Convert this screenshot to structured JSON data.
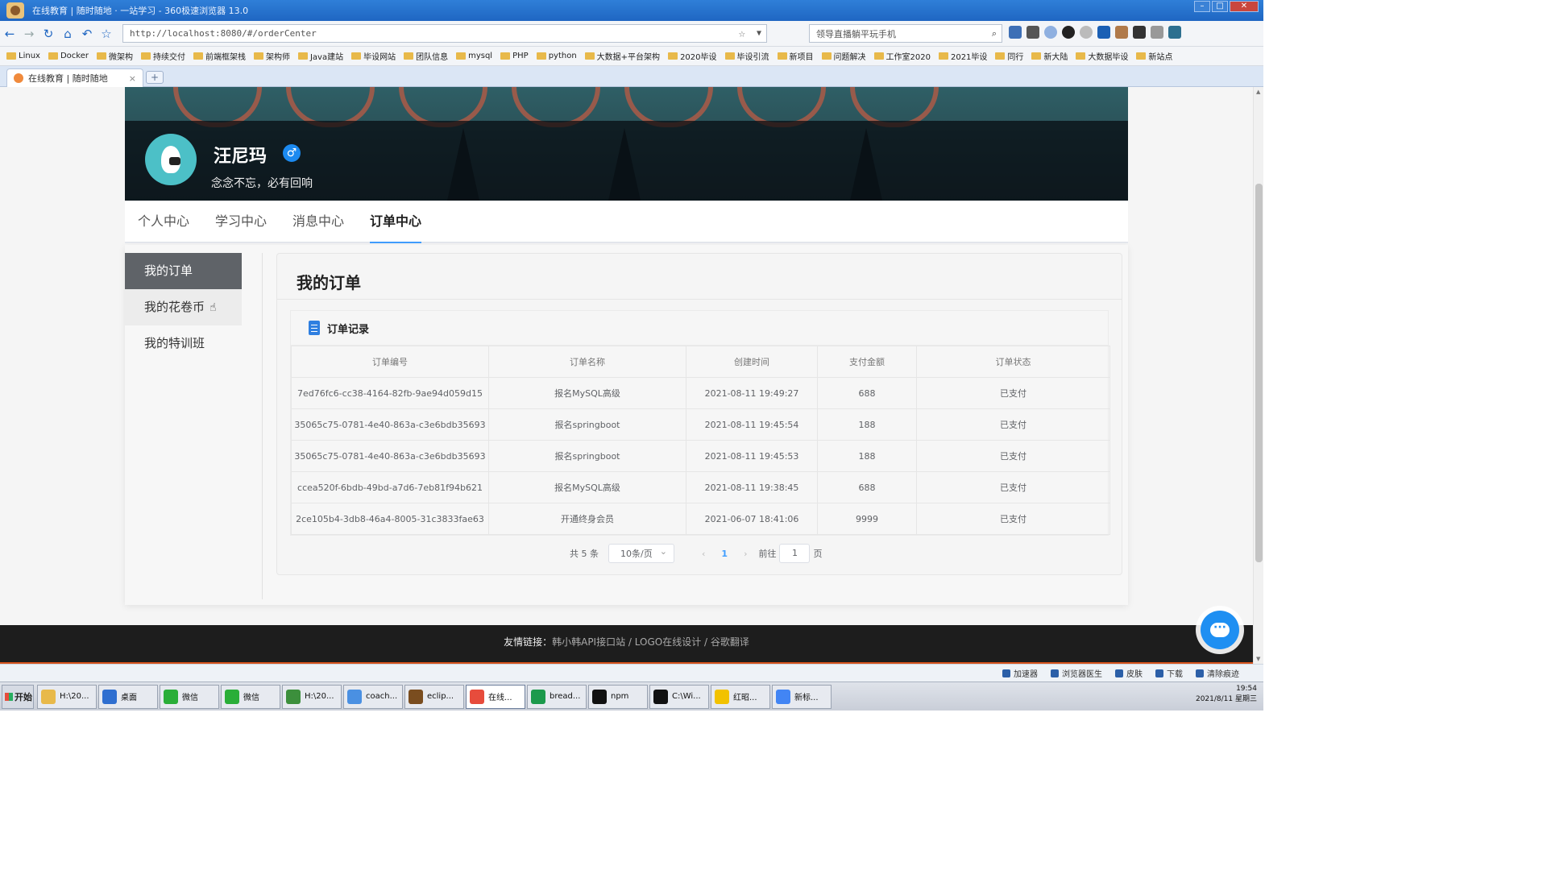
{
  "browser": {
    "title": "在线教育 | 随时随地 · 一站学习 - 360极速浏览器 13.0",
    "address": "http://localhost:8080/#/orderCenter",
    "search_placeholder": "领导直播躺平玩手机",
    "tab_title": "在线教育 | 随时随地",
    "bookmarks": [
      "Linux",
      "Docker",
      "微架构",
      "持续交付",
      "前端框架栈",
      "架构师",
      "Java建站",
      "毕设网站",
      "团队信息",
      "mysql",
      "PHP",
      "python",
      "大数据+平台架构",
      "2020毕设",
      "毕设引流",
      "新项目",
      "问题解决",
      "工作室2020",
      "2021毕设",
      "同行",
      "新大陆",
      "大数据毕设",
      "新站点"
    ]
  },
  "profile": {
    "name": "汪尼玛",
    "gender_symbol": "♂",
    "motto": "念念不忘，必有回响"
  },
  "nav_tabs": [
    "个人中心",
    "学习中心",
    "消息中心",
    "订单中心"
  ],
  "sidebar": [
    "我的订单",
    "我的花卷币",
    "我的特训班"
  ],
  "panel": {
    "title": "我的订单",
    "card_title": "订单记录",
    "columns": [
      "订单编号",
      "订单名称",
      "创建时间",
      "支付金额",
      "订单状态"
    ],
    "rows": [
      [
        "7ed76fc6-cc38-4164-82fb-9ae94d059d15",
        "报名MySQL高级",
        "2021-08-11 19:49:27",
        "688",
        "已支付"
      ],
      [
        "35065c75-0781-4e40-863a-c3e6bdb35693",
        "报名springboot",
        "2021-08-11 19:45:54",
        "188",
        "已支付"
      ],
      [
        "35065c75-0781-4e40-863a-c3e6bdb35693",
        "报名springboot",
        "2021-08-11 19:45:53",
        "188",
        "已支付"
      ],
      [
        "ccea520f-6bdb-49bd-a7d6-7eb81f94b621",
        "报名MySQL高级",
        "2021-08-11 19:38:45",
        "688",
        "已支付"
      ],
      [
        "2ce105b4-3db8-46a4-8005-31c3833fae63",
        "开通终身会员",
        "2021-06-07 18:41:06",
        "9999",
        "已支付"
      ]
    ],
    "pager": {
      "total": "共 5 条",
      "page_size": "10条/页",
      "current": "1",
      "goto_prefix": "前往",
      "goto_value": "1",
      "goto_suffix": "页"
    }
  },
  "footer": {
    "label": "友情链接：",
    "links": "韩小韩API接口站 / LOGO在线设计 / 谷歌翻译"
  },
  "statusbar": [
    "加速器",
    "浏览器医生",
    "皮肤",
    "下载",
    "清除痕迹"
  ],
  "taskbar": {
    "start": "开始",
    "items": [
      "H:\\20...",
      "桌面",
      "微信",
      "微信",
      "H:\\20...",
      "coach...",
      "eclip...",
      "在线...",
      "bread...",
      "npm",
      "C:\\Wi...",
      "红昭...",
      "新标..."
    ],
    "clock_time": "19:54",
    "clock_date": "2021/8/11 星期三"
  },
  "colors": {
    "accent": "#409eff",
    "sidebar_active": "#5f6368",
    "footer_bg": "#1d1d1d",
    "chat_button": "#1e8ff2"
  }
}
